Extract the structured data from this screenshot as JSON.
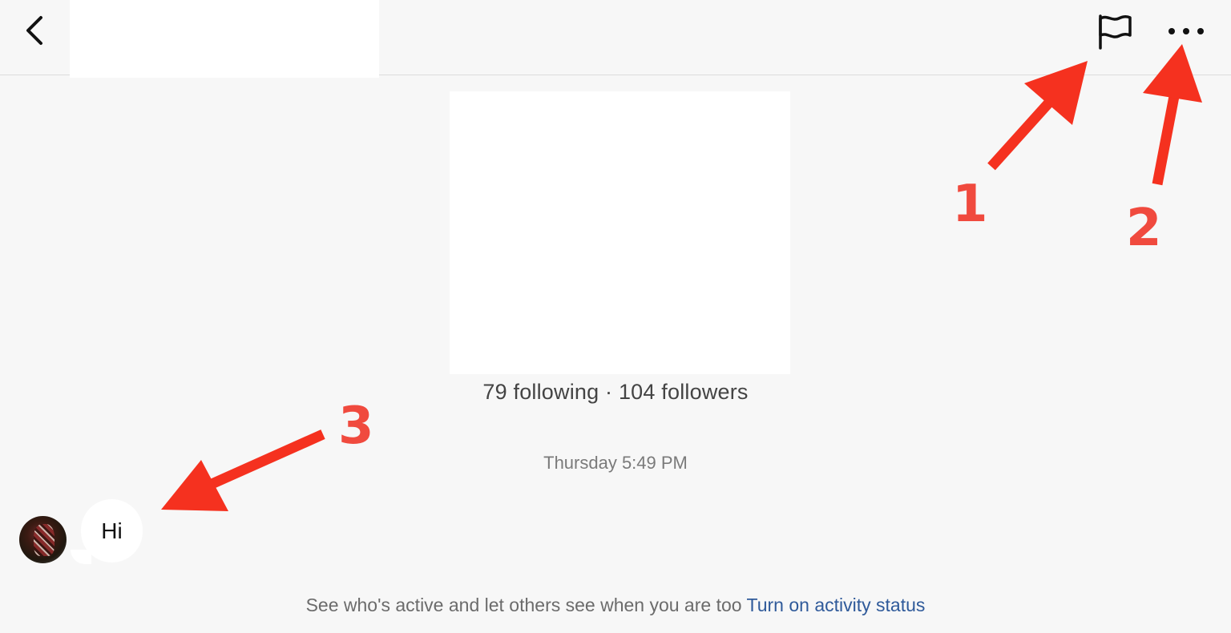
{
  "header": {
    "back_icon": "chevron-left-icon",
    "flag_icon": "flag-icon",
    "more_icon": "more-horizontal-icon"
  },
  "profile": {
    "stats": "79 following · 104 followers"
  },
  "conversation": {
    "timestamp": "Thursday 5:49 PM",
    "messages": [
      {
        "text": "Hi"
      }
    ]
  },
  "footer": {
    "text": "See who's active and let others see when you are too",
    "link": "Turn on activity status"
  },
  "annotations": {
    "arrow_color": "#f5311f",
    "label_1": "1",
    "label_2": "2",
    "label_3": "3"
  }
}
